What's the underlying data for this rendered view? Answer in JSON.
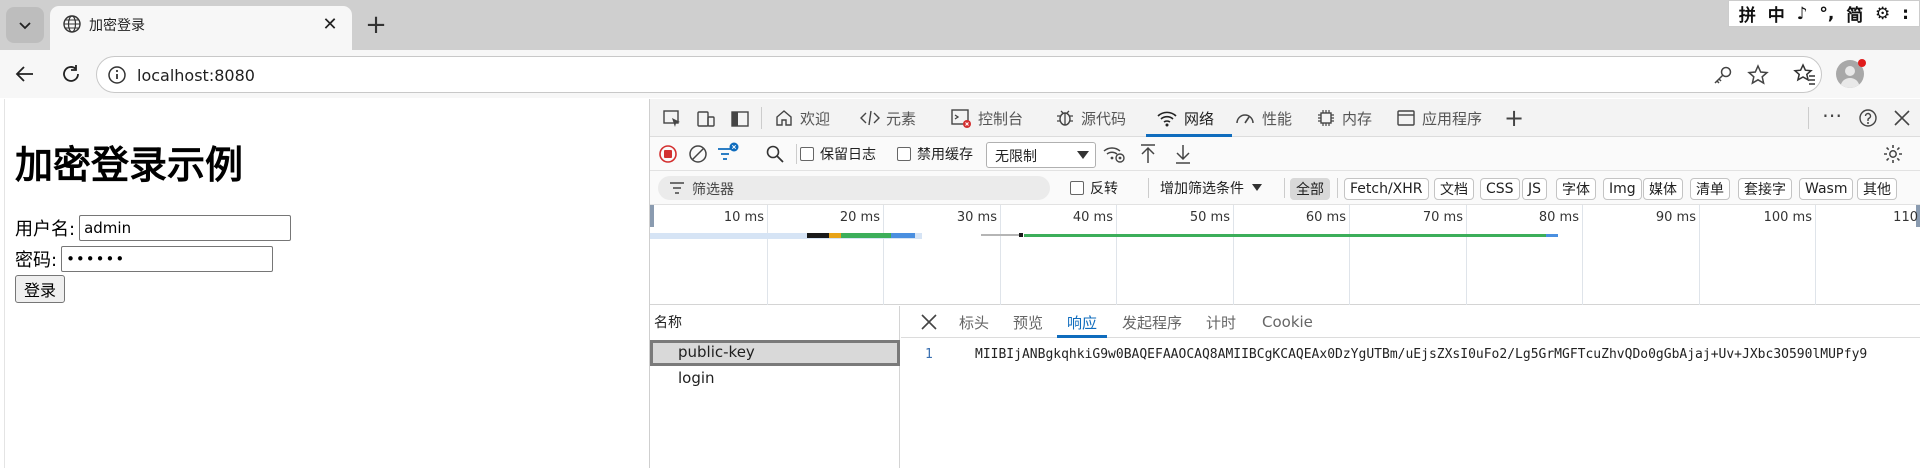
{
  "browser": {
    "tab_title": "加密登录",
    "url": "localhost:8080",
    "ime": [
      "拼",
      "中",
      "♪",
      "°,",
      "简",
      "⚙",
      ":"
    ]
  },
  "page": {
    "title": "加密登录示例",
    "username_label": "用户名:",
    "username_value": "admin",
    "password_label": "密码:",
    "password_value": "••••••",
    "login_button": "登录"
  },
  "devtools": {
    "tabs": [
      {
        "label": "欢迎",
        "icon": "home-icon"
      },
      {
        "label": "元素",
        "icon": "code-icon"
      },
      {
        "label": "控制台",
        "icon": "console-icon"
      },
      {
        "label": "源代码",
        "icon": "bug-icon"
      },
      {
        "label": "网络",
        "icon": "wifi-icon",
        "active": true
      },
      {
        "label": "性能",
        "icon": "gauge-icon"
      },
      {
        "label": "内存",
        "icon": "chip-icon"
      },
      {
        "label": "应用程序",
        "icon": "app-icon"
      }
    ],
    "network_toolbar": {
      "preserve_log": "保留日志",
      "disable_cache": "禁用缓存",
      "throttle": "无限制"
    },
    "filter": {
      "placeholder": "筛选器",
      "invert": "反转",
      "more_filters": "增加筛选条件",
      "types": [
        "全部",
        "Fetch/XHR",
        "文档",
        "CSS",
        "JS",
        "字体",
        "Img",
        "媒体",
        "清单",
        "套接字",
        "Wasm",
        "其他"
      ]
    },
    "timeline": {
      "ticks": [
        "10 ms",
        "20 ms",
        "30 ms",
        "40 ms",
        "50 ms",
        "60 ms",
        "70 ms",
        "80 ms",
        "90 ms",
        "100 ms",
        "110"
      ]
    },
    "requests": {
      "header": "名称",
      "items": [
        "public-key",
        "login"
      ]
    },
    "detail": {
      "tabs": [
        "标头",
        "预览",
        "响应",
        "发起程序",
        "计时",
        "Cookie"
      ],
      "active_tab": "响应",
      "line_number": "1",
      "response_text": "MIIBIjANBgkqhkiG9w0BAQEFAAOCAQ8AMIIBCgKCAQEAx0DzYgUTBm/uEjsZXsI0uFo2/Lg5GrMGFTcuZhvQDo0gGbAjaj+Uv+JXbc3O590lMUPfy9"
    },
    "colors": {
      "accent": "#0f6cbd",
      "record_red": "#d32f2f"
    }
  }
}
